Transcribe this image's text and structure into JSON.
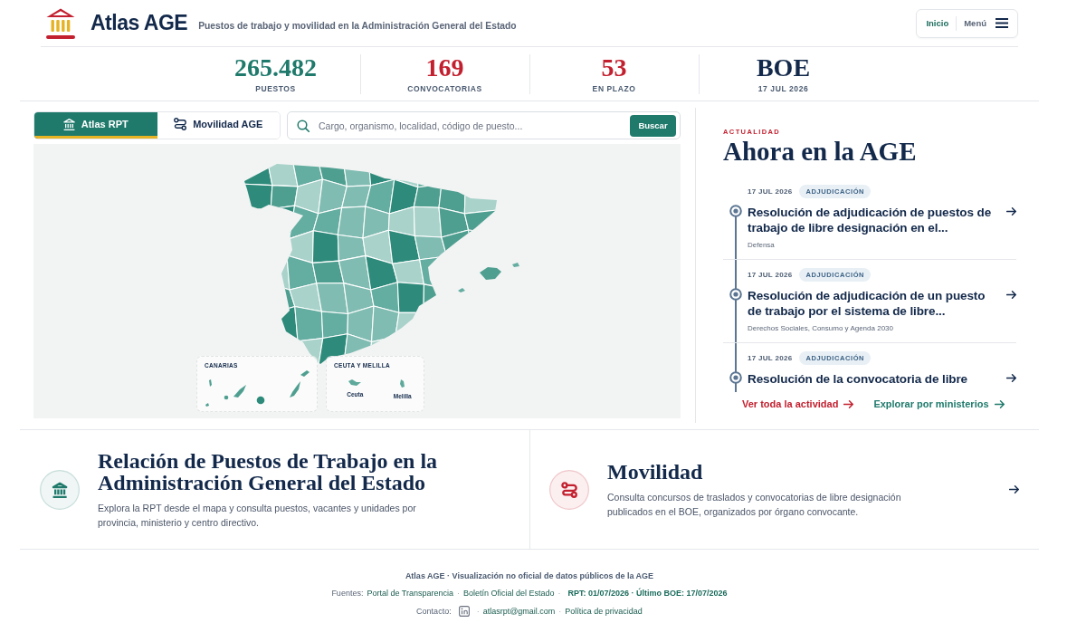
{
  "header": {
    "brand": "Atlas AGE",
    "tagline": "Puestos de trabajo y movilidad en la Administración General del Estado",
    "nav": [
      {
        "kind": "link",
        "label": "Inicio",
        "selected": true
      },
      {
        "kind": "menu",
        "label": "Menú",
        "selected": false
      }
    ]
  },
  "stats": [
    {
      "value": "265.482",
      "label": "PUESTOS",
      "color": "#1f7a6c"
    },
    {
      "value": "169",
      "label": "CONVOCATORIAS",
      "color": "#c3202f"
    },
    {
      "value": "53",
      "label": "EN PLAZO",
      "color": "#c3202f"
    },
    {
      "value": "BOE",
      "label": "17 JUL 2026",
      "color": "#13294b"
    }
  ],
  "tabs": [
    {
      "kind": "rpt",
      "label": "Atlas RPT",
      "selected": true
    },
    {
      "kind": "mobility",
      "label": "Movilidad AGE",
      "selected": false
    }
  ],
  "search": {
    "placeholder": "Cargo, organismo, localidad, código de puesto...",
    "button": "Buscar"
  },
  "map": {
    "insets": [
      {
        "kind": "canarias",
        "title": "CANARIAS"
      },
      {
        "kind": "enclaves",
        "title": "CEUTA Y MELILLA",
        "places": [
          "Ceuta",
          "Melilla"
        ]
      }
    ]
  },
  "news": {
    "eyebrow": "ACTUALIDAD",
    "title": "Ahora en la AGE",
    "items": [
      {
        "date": "17 JUL 2026",
        "tag": "ADJUDICACIÓN",
        "title": "Resolución de adjudicación de puestos de trabajo de libre designación en el...",
        "ministry": "Defensa"
      },
      {
        "date": "17 JUL 2026",
        "tag": "ADJUDICACIÓN",
        "title": "Resolución de adjudicación de un puesto de trabajo por el sistema de libre...",
        "ministry": "Derechos Sociales, Consumo y Agenda 2030"
      },
      {
        "date": "17 JUL 2026",
        "tag": "ADJUDICACIÓN",
        "title": "Resolución de la convocatoria de libre"
      }
    ],
    "links": [
      {
        "label": "Ver toda la actividad",
        "color": "#c3202f"
      },
      {
        "label": "Explorar por ministerios",
        "color": "#1f7a6c"
      }
    ]
  },
  "cards": [
    {
      "kind": "rpt",
      "title": "Relación de Puestos de Trabajo en la Administración General del Estado",
      "text": "Explora la RPT desde el mapa y consulta puestos, vacantes y unidades por provincia, ministerio y centro directivo.",
      "color": "#1f7a6c",
      "arrow": false
    },
    {
      "kind": "mobility",
      "title": "Movilidad",
      "text": "Consulta concursos de traslados y convocatorias de libre designación publicados en el BOE, organizados por órgano convocante.",
      "color": "#c3202f",
      "arrow": true
    }
  ],
  "footer": {
    "note": "Atlas AGE · Visualización no oficial de datos públicos de la AGE",
    "lines": [
      [
        {
          "kind": "label",
          "text": "Fuentes:"
        },
        {
          "kind": "link",
          "text": "Portal de Transparencia"
        },
        {
          "kind": "sep",
          "text": "·"
        },
        {
          "kind": "link",
          "text": "Boletín Oficial del Estado"
        },
        {
          "kind": "sep",
          "text": "·"
        },
        {
          "kind": "strong",
          "text": "RPT: 01/07/2026 · Último BOE: 17/07/2026"
        }
      ],
      [
        {
          "kind": "label",
          "text": "Contacto:"
        },
        {
          "kind": "icon"
        },
        {
          "kind": "sep",
          "text": "·"
        },
        {
          "kind": "link",
          "text": "atlasrpt@gmail.com"
        },
        {
          "kind": "sep",
          "text": "·"
        },
        {
          "kind": "link",
          "text": "Política de privacidad"
        }
      ]
    ]
  }
}
